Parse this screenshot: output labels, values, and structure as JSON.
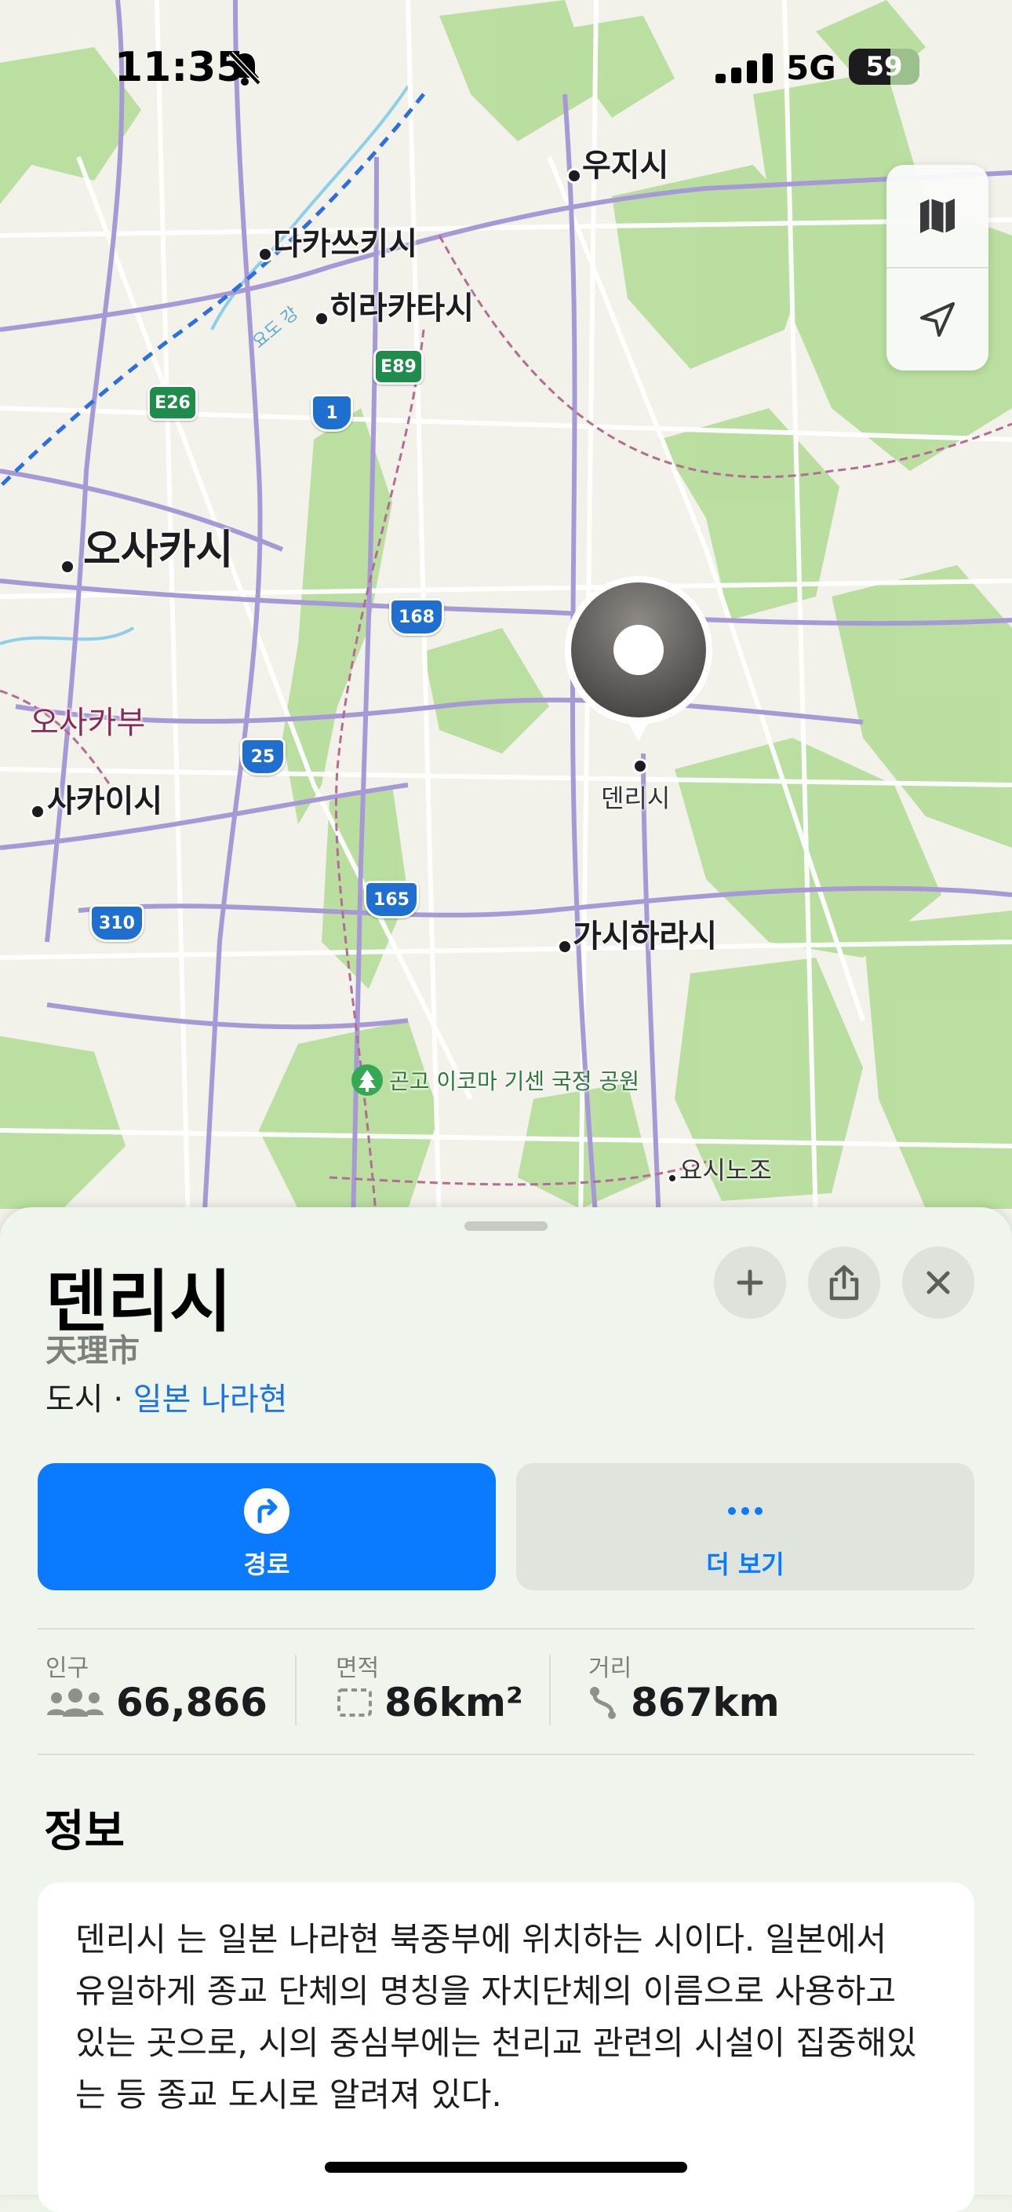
{
  "status_bar": {
    "time": "11:35",
    "network": "5G",
    "battery": "59",
    "battery_level": 0.59
  },
  "map": {
    "labels": {
      "uji": "우지시",
      "takatsuki": "다카쓰키시",
      "hirakata": "히라카타시",
      "osaka": "오사카시",
      "osaka_prefecture": "오사카부",
      "sakai": "사카이시",
      "tenri": "덴리시",
      "kashihara": "가시하라시",
      "park": "곤고 이코마 기센 국정 공원",
      "yoshino": "요시노조",
      "river": "요도 강"
    },
    "shields": {
      "e26": "E26",
      "e89": "E89",
      "r1": "1",
      "r168": "168",
      "r25": "25",
      "r165": "165",
      "r310": "310"
    },
    "controls": [
      "map-mode-icon",
      "location-arrow-icon"
    ]
  },
  "place": {
    "title": "덴리시",
    "native_name": "天理市",
    "type": "도시",
    "separator": " · ",
    "region_link": "일본 나라현"
  },
  "actions": {
    "directions_label": "경로",
    "more_label": "더 보기"
  },
  "stats": {
    "population_label": "인구",
    "population_value": "66,866",
    "area_label": "면적",
    "area_value": "86km²",
    "distance_label": "거리",
    "distance_value": "867km"
  },
  "info": {
    "section_title": "정보",
    "text": "덴리시 는 일본 나라현 북중부에 위치하는 시이다. 일본에서 유일하게 종교 단체의 명칭을 자치단체의 이름으로 사용하고 있는 곳으로, 시의 중심부에는 천리교 관련의 시설이 집중해있는 등 종교 도시로 알려져 있다."
  },
  "colors": {
    "accent": "#0a7aff",
    "forest": "#a9d88f",
    "prefecture_border": "#a0507a",
    "route": "#8e7bc4"
  }
}
